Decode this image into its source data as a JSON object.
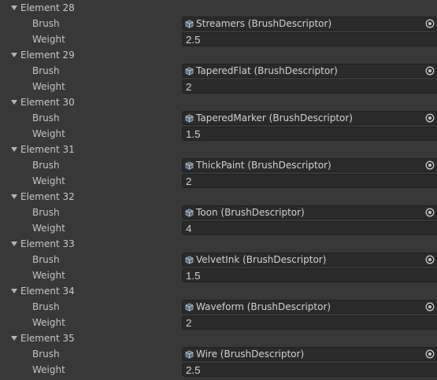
{
  "inspector": {
    "elements": [
      {
        "header": "Element 28",
        "brush_label": "Brush",
        "brush_value": "Streamers (BrushDescriptor)",
        "weight_label": "Weight",
        "weight_value": "2.5"
      },
      {
        "header": "Element 29",
        "brush_label": "Brush",
        "brush_value": "TaperedFlat (BrushDescriptor)",
        "weight_label": "Weight",
        "weight_value": "2"
      },
      {
        "header": "Element 30",
        "brush_label": "Brush",
        "brush_value": "TaperedMarker (BrushDescriptor)",
        "weight_label": "Weight",
        "weight_value": "1.5"
      },
      {
        "header": "Element 31",
        "brush_label": "Brush",
        "brush_value": "ThickPaint (BrushDescriptor)",
        "weight_label": "Weight",
        "weight_value": "2"
      },
      {
        "header": "Element 32",
        "brush_label": "Brush",
        "brush_value": "Toon (BrushDescriptor)",
        "weight_label": "Weight",
        "weight_value": "4"
      },
      {
        "header": "Element 33",
        "brush_label": "Brush",
        "brush_value": "VelvetInk (BrushDescriptor)",
        "weight_label": "Weight",
        "weight_value": "1.5"
      },
      {
        "header": "Element 34",
        "brush_label": "Brush",
        "brush_value": "Waveform (BrushDescriptor)",
        "weight_label": "Weight",
        "weight_value": "2"
      },
      {
        "header": "Element 35",
        "brush_label": "Brush",
        "brush_value": "Wire (BrushDescriptor)",
        "weight_label": "Weight",
        "weight_value": "2.5"
      }
    ],
    "colors": {
      "background": "#383838",
      "field_background": "#2a2a2a",
      "field_border": "#212121",
      "text": "#c4c4c4",
      "asset_icon_accent": "#7fb2d6"
    },
    "icons": {
      "foldout": "foldout-expanded-triangle-icon",
      "asset": "scriptable-object-asset-icon",
      "picker": "object-picker-target-icon"
    }
  }
}
